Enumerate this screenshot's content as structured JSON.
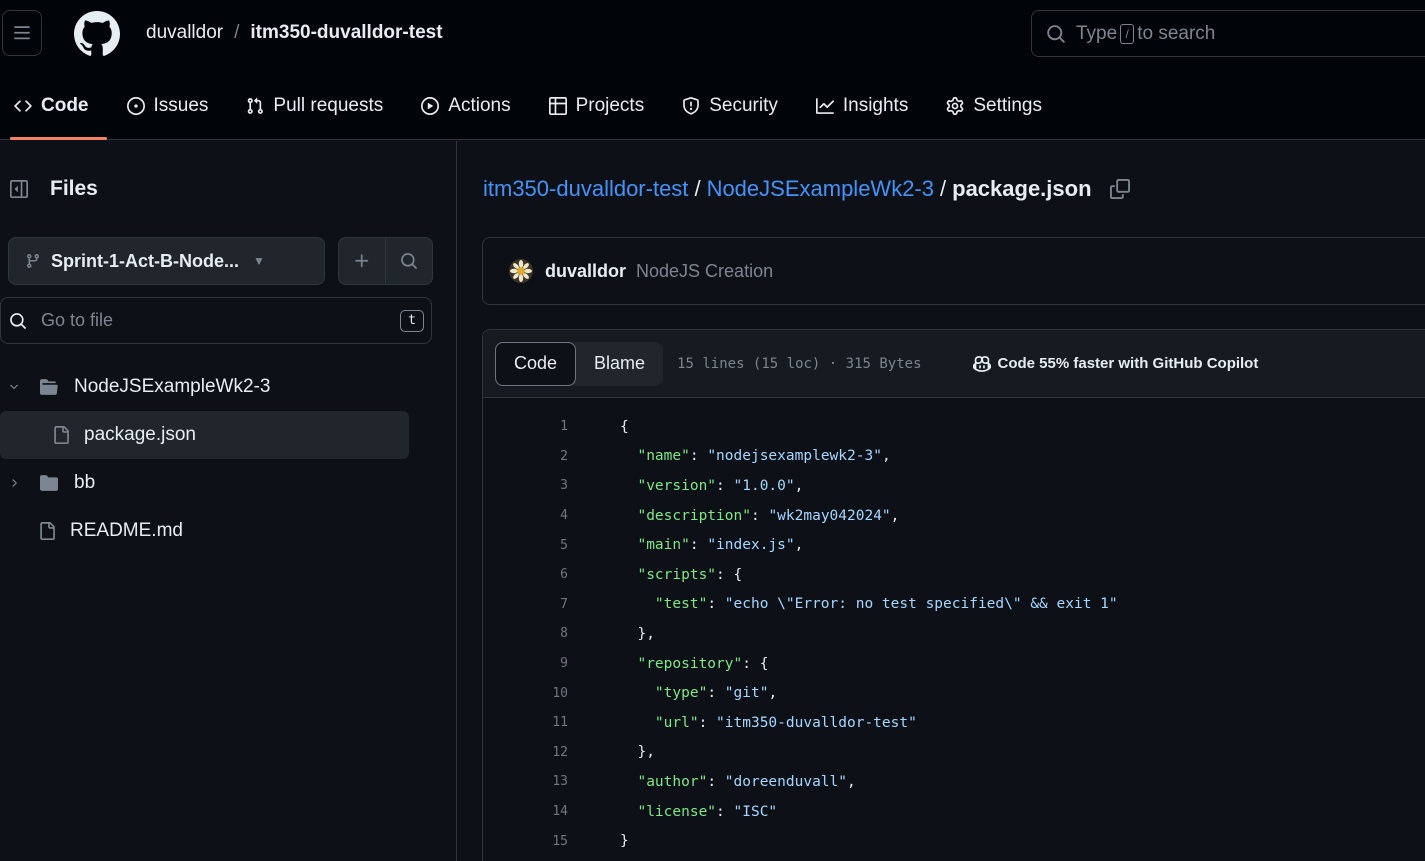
{
  "header": {
    "owner": "duvalldor",
    "separator": "/",
    "repo": "itm350-duvalldor-test",
    "search": {
      "prefix": "Type",
      "key": "/",
      "suffix": "to search"
    }
  },
  "nav": {
    "tabs": [
      {
        "label": "Code",
        "icon": "code-icon",
        "selected": true
      },
      {
        "label": "Issues",
        "icon": "issue-icon"
      },
      {
        "label": "Pull requests",
        "icon": "pull-request-icon"
      },
      {
        "label": "Actions",
        "icon": "play-icon"
      },
      {
        "label": "Projects",
        "icon": "table-icon"
      },
      {
        "label": "Security",
        "icon": "shield-icon"
      },
      {
        "label": "Insights",
        "icon": "graph-icon"
      },
      {
        "label": "Settings",
        "icon": "gear-icon"
      }
    ]
  },
  "sidebar": {
    "title": "Files",
    "branch": "Sprint-1-Act-B-Node...",
    "goto_placeholder": "Go to file",
    "goto_key": "t",
    "tree": [
      {
        "name": "NodeJSExampleWk2-3",
        "type": "folder",
        "expanded": true
      },
      {
        "name": "package.json",
        "type": "file",
        "selected": true
      },
      {
        "name": "bb",
        "type": "folder",
        "expanded": false
      },
      {
        "name": "README.md",
        "type": "file"
      }
    ]
  },
  "main": {
    "breadcrumb": {
      "repo": "itm350-duvalldor-test",
      "folder": "NodeJSExampleWk2-3",
      "sep": "/",
      "file": "package.json"
    },
    "commit": {
      "author": "duvalldor",
      "message": "NodeJS Creation"
    },
    "toolbar": {
      "code_tab": "Code",
      "blame_tab": "Blame",
      "file_info": "15 lines (15 loc) · 315 Bytes",
      "copilot": "Code 55% faster with GitHub Copilot"
    },
    "code": [
      {
        "n": "1",
        "tokens": [
          {
            "t": "p",
            "v": "{"
          }
        ]
      },
      {
        "n": "2",
        "tokens": [
          {
            "t": "p",
            "v": "  "
          },
          {
            "t": "k",
            "v": "\"name\""
          },
          {
            "t": "p",
            "v": ": "
          },
          {
            "t": "s",
            "v": "\"nodejsexamplewk2-3\""
          },
          {
            "t": "p",
            "v": ","
          }
        ]
      },
      {
        "n": "3",
        "tokens": [
          {
            "t": "p",
            "v": "  "
          },
          {
            "t": "k",
            "v": "\"version\""
          },
          {
            "t": "p",
            "v": ": "
          },
          {
            "t": "s",
            "v": "\"1.0.0\""
          },
          {
            "t": "p",
            "v": ","
          }
        ]
      },
      {
        "n": "4",
        "tokens": [
          {
            "t": "p",
            "v": "  "
          },
          {
            "t": "k",
            "v": "\"description\""
          },
          {
            "t": "p",
            "v": ": "
          },
          {
            "t": "s",
            "v": "\"wk2may042024\""
          },
          {
            "t": "p",
            "v": ","
          }
        ]
      },
      {
        "n": "5",
        "tokens": [
          {
            "t": "p",
            "v": "  "
          },
          {
            "t": "k",
            "v": "\"main\""
          },
          {
            "t": "p",
            "v": ": "
          },
          {
            "t": "s",
            "v": "\"index.js\""
          },
          {
            "t": "p",
            "v": ","
          }
        ]
      },
      {
        "n": "6",
        "tokens": [
          {
            "t": "p",
            "v": "  "
          },
          {
            "t": "k",
            "v": "\"scripts\""
          },
          {
            "t": "p",
            "v": ": {"
          }
        ]
      },
      {
        "n": "7",
        "tokens": [
          {
            "t": "p",
            "v": "    "
          },
          {
            "t": "k",
            "v": "\"test\""
          },
          {
            "t": "p",
            "v": ": "
          },
          {
            "t": "s",
            "v": "\"echo \\\"Error: no test specified\\\" && exit 1\""
          }
        ]
      },
      {
        "n": "8",
        "tokens": [
          {
            "t": "p",
            "v": "  },"
          }
        ]
      },
      {
        "n": "9",
        "tokens": [
          {
            "t": "p",
            "v": "  "
          },
          {
            "t": "k",
            "v": "\"repository\""
          },
          {
            "t": "p",
            "v": ": {"
          }
        ]
      },
      {
        "n": "10",
        "tokens": [
          {
            "t": "p",
            "v": "    "
          },
          {
            "t": "k",
            "v": "\"type\""
          },
          {
            "t": "p",
            "v": ": "
          },
          {
            "t": "s",
            "v": "\"git\""
          },
          {
            "t": "p",
            "v": ","
          }
        ]
      },
      {
        "n": "11",
        "tokens": [
          {
            "t": "p",
            "v": "    "
          },
          {
            "t": "k",
            "v": "\"url\""
          },
          {
            "t": "p",
            "v": ": "
          },
          {
            "t": "s",
            "v": "\"itm350-duvalldor-test\""
          }
        ]
      },
      {
        "n": "12",
        "tokens": [
          {
            "t": "p",
            "v": "  },"
          }
        ]
      },
      {
        "n": "13",
        "tokens": [
          {
            "t": "p",
            "v": "  "
          },
          {
            "t": "k",
            "v": "\"author\""
          },
          {
            "t": "p",
            "v": ": "
          },
          {
            "t": "s",
            "v": "\"doreenduvall\""
          },
          {
            "t": "p",
            "v": ","
          }
        ]
      },
      {
        "n": "14",
        "tokens": [
          {
            "t": "p",
            "v": "  "
          },
          {
            "t": "k",
            "v": "\"license\""
          },
          {
            "t": "p",
            "v": ": "
          },
          {
            "t": "s",
            "v": "\"ISC\""
          }
        ]
      },
      {
        "n": "15",
        "tokens": [
          {
            "t": "p",
            "v": "}"
          }
        ]
      }
    ]
  },
  "colors": {
    "background": "#0d1117",
    "link": "#4493f8",
    "json_key": "#7ee787",
    "json_string": "#a5d6ff",
    "selected_tab_underline": "#f78166"
  }
}
